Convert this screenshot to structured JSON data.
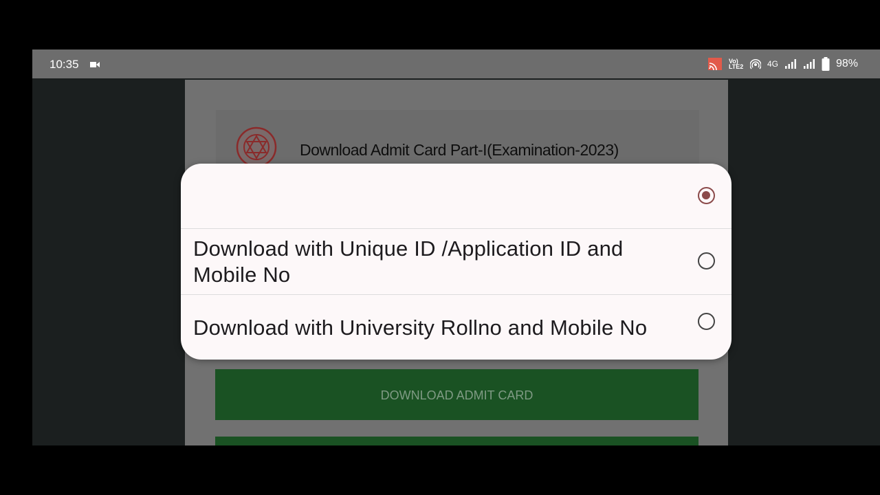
{
  "status_bar": {
    "time": "10:35",
    "network_volte": "Vo) LTE2",
    "network_type": "4G",
    "battery": "98%",
    "icons": [
      "video-record-icon",
      "cast-icon",
      "hotspot-icon",
      "signal-icon",
      "battery-icon"
    ]
  },
  "page": {
    "card_title": "Download Admit Card Part-I(Examination-2023)",
    "download_button": "DOWNLOAD ADMIT CARD"
  },
  "dialog": {
    "options": [
      {
        "label": "",
        "selected": true
      },
      {
        "label": "Download with Unique ID /Application ID and Mobile No",
        "selected": false
      },
      {
        "label": "Download with University Rollno and Mobile No",
        "selected": false
      }
    ]
  },
  "colors": {
    "accent_radio": "#8b4a4a",
    "button_green": "#1a5223",
    "dialog_bg": "#fdf8f9"
  }
}
